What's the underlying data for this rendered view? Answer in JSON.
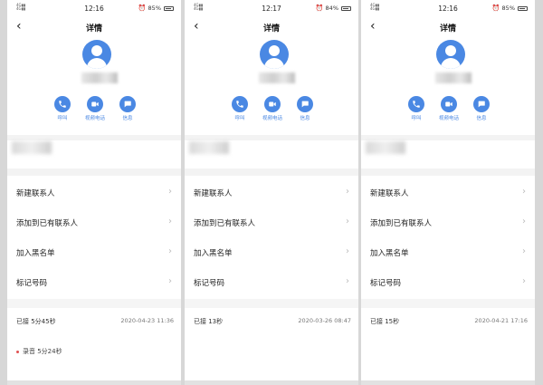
{
  "screens": [
    {
      "status": {
        "time": "12:16",
        "battery": "85%"
      },
      "nav": {
        "title": "详情"
      },
      "actions": [
        {
          "label": "呼叫"
        },
        {
          "label": "视频电话"
        },
        {
          "label": "信息"
        }
      ],
      "menu": [
        "新建联系人",
        "添加到已有联系人",
        "加入黑名单",
        "标记号码"
      ],
      "call": {
        "duration": "已接 5分45秒",
        "datetime": "2020-04-23 11:36"
      },
      "recording": "录音 5分24秒"
    },
    {
      "status": {
        "time": "12:17",
        "battery": "84%"
      },
      "nav": {
        "title": "详情"
      },
      "actions": [
        {
          "label": "呼叫"
        },
        {
          "label": "视频电话"
        },
        {
          "label": "信息"
        }
      ],
      "menu": [
        "新建联系人",
        "添加到已有联系人",
        "加入黑名单",
        "标记号码"
      ],
      "call": {
        "duration": "已接 13秒",
        "datetime": "2020-03-26 08:47"
      }
    },
    {
      "status": {
        "time": "12:16",
        "battery": "85%"
      },
      "nav": {
        "title": "详情"
      },
      "actions": [
        {
          "label": "呼叫"
        },
        {
          "label": "视频电话"
        },
        {
          "label": "信息"
        }
      ],
      "menu": [
        "新建联系人",
        "添加到已有联系人",
        "加入黑名单",
        "标记号码"
      ],
      "call": {
        "duration": "已接 15秒",
        "datetime": "2020-04-21 17:16"
      }
    }
  ],
  "icons": {
    "call": "phone-icon",
    "video": "video-camera-icon",
    "message": "chat-bubble-icon",
    "back": "back-arrow-icon",
    "chevron": "chevron-right-icon",
    "avatar": "default-avatar-icon"
  },
  "colors": {
    "accent": "#4a88e3",
    "record_dot": "#e05050",
    "chevron": "#bbbbbb"
  }
}
